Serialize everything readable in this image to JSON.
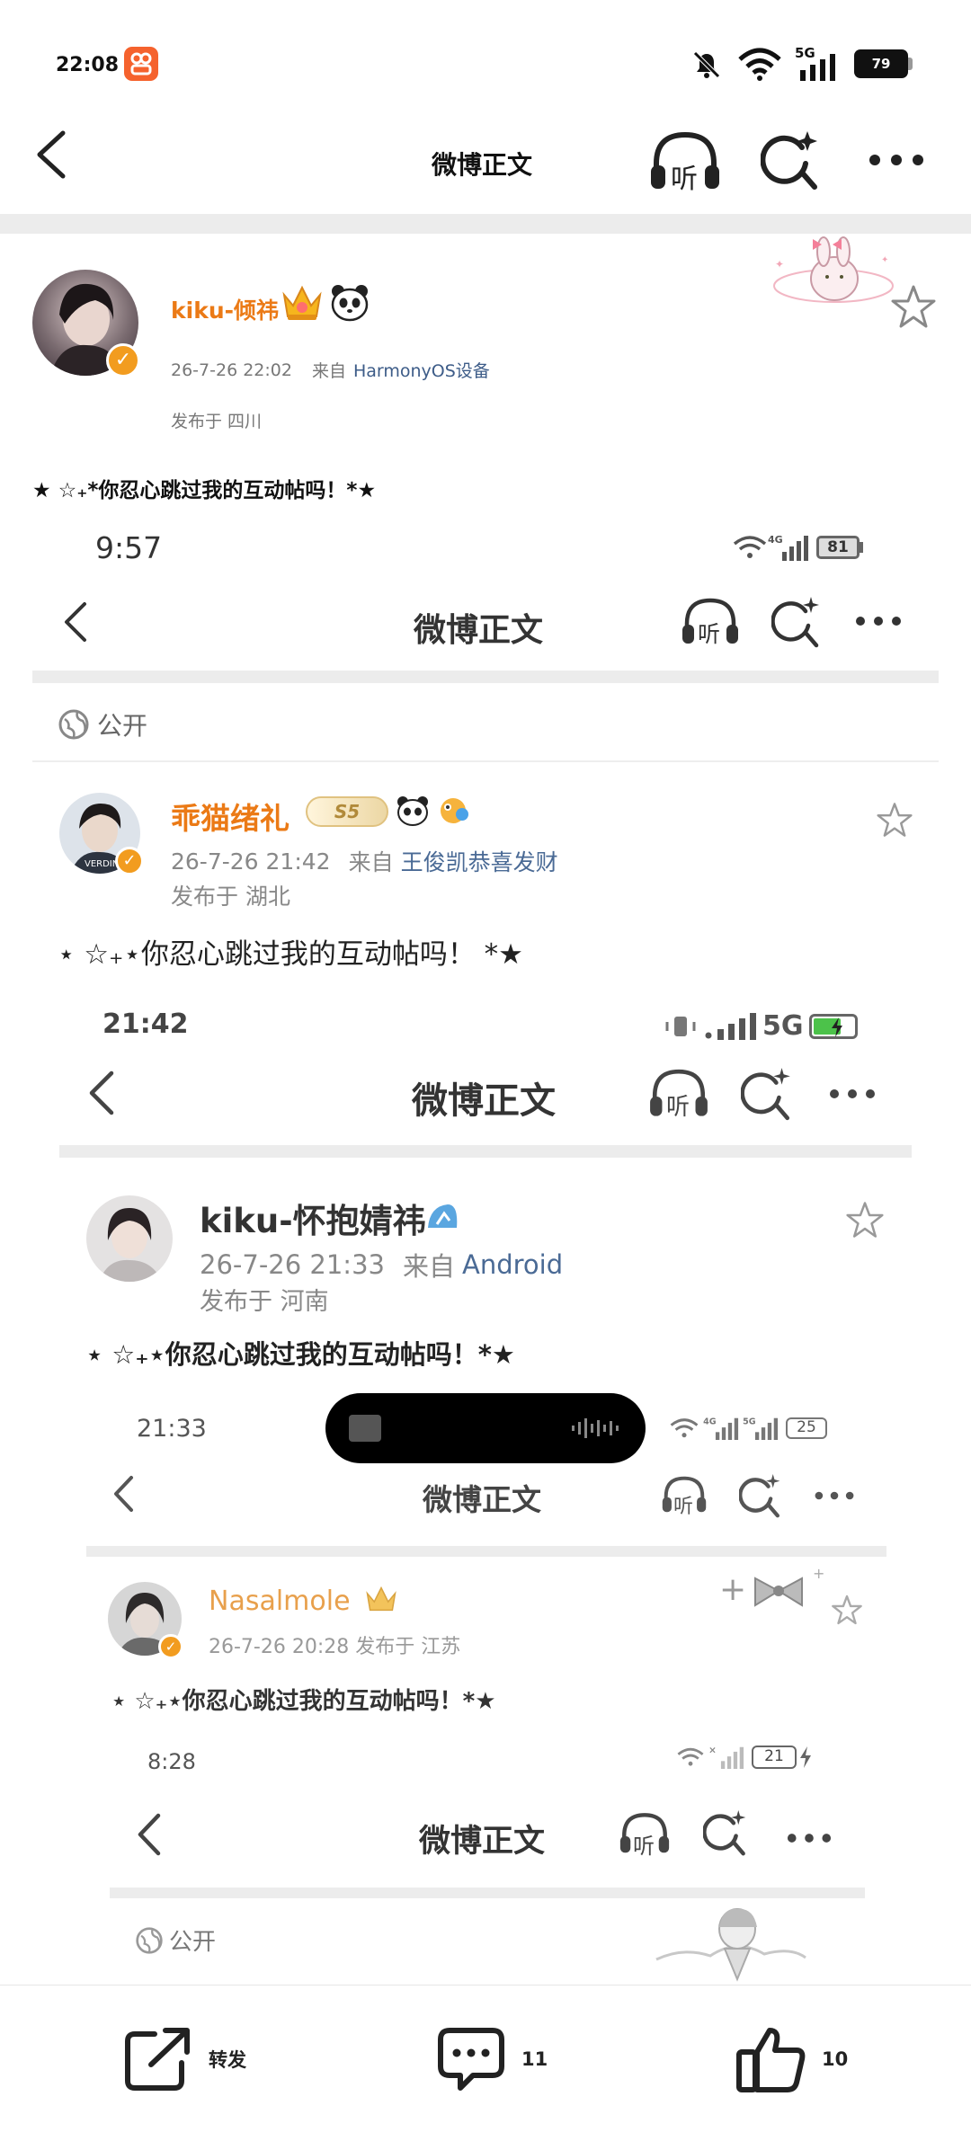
{
  "status": {
    "time": "22:08",
    "battery": "79",
    "network": "5G"
  },
  "nav": {
    "title": "微博正文",
    "listen": "听"
  },
  "post": {
    "username": "kiku-倾祎",
    "timestamp": "26-7-26 22:02",
    "source_prefix": "来自",
    "source": "HarmonyOS设备",
    "location": "发布于 四川",
    "text": "★ ☆₊*你忍心跳过我的互动帖吗！*★"
  },
  "shot1": {
    "time": "9:57",
    "battery": "81",
    "title": "微博正文",
    "listen": "听",
    "visibility": "公开",
    "username": "乖猫绪礼",
    "level": "S5",
    "timestamp": "26-7-26 21:42",
    "source_prefix": "来自",
    "source": "王俊凯恭喜发财",
    "location": "发布于 湖北",
    "text": "⋆ ☆₊⋆你忍心跳过我的互动帖吗！ *★"
  },
  "shot2": {
    "time": "21:42",
    "network": "5G",
    "title": "微博正文",
    "listen": "听",
    "username": "kiku-怀抱婧祎",
    "timestamp": "26-7-26 21:33",
    "source_prefix": "来自",
    "source": "Android",
    "location": "发布于 河南",
    "text": "⋆ ☆₊⋆你忍心跳过我的互动帖吗！*★"
  },
  "shot3": {
    "time": "21:33",
    "battery": "25",
    "title": "微博正文",
    "listen": "听",
    "username": "Nasalmole",
    "meta": "26-7-26 20:28  发布于 江苏",
    "text": "⋆ ☆₊⋆你忍心跳过我的互动帖吗！*★"
  },
  "shot4": {
    "time": "8:28",
    "battery": "21",
    "title": "微博正文",
    "listen": "听",
    "visibility": "公开"
  },
  "actions": {
    "repost_label": "转发",
    "comment_count": "11",
    "like_count": "10"
  },
  "colors": {
    "accent_orange": "#eb7a16",
    "link_blue": "#3d5c88",
    "badge_orange": "#f29c1f"
  }
}
